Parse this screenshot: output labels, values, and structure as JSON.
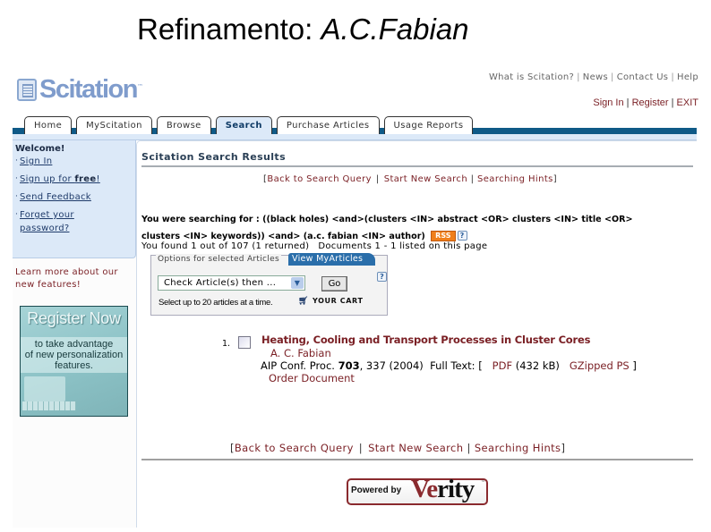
{
  "slide": {
    "title_prefix": "Refinamento: ",
    "title_italic": "A.C.Fabian"
  },
  "header": {
    "logo_text": "Scitation",
    "logo_tm": "™",
    "top_links": [
      "What is Scitation?",
      "News",
      "Contact Us",
      "Help"
    ],
    "auth_links": [
      "Sign In",
      "Register",
      "EXIT"
    ]
  },
  "tabs": [
    {
      "label": "Home",
      "active": false
    },
    {
      "label": "MyScitation",
      "active": false
    },
    {
      "label": "Browse",
      "active": false
    },
    {
      "label": "Search",
      "active": true
    },
    {
      "label": "Purchase Articles",
      "active": false
    },
    {
      "label": "Usage Reports",
      "active": false
    }
  ],
  "sidebar": {
    "welcome_heading": "Welcome!",
    "items": [
      {
        "label": "Sign In"
      },
      {
        "label_prefix": "Sign up for ",
        "label_bold": "free",
        "label_suffix": "!"
      },
      {
        "label": "Send Feedback"
      },
      {
        "label_line1": "Forget your",
        "label_line2": "password?"
      }
    ],
    "learn_more": "Learn more about our new features!",
    "promo": {
      "heading": "Register Now",
      "body_line1": "to take advantage",
      "body_line2": "of new personalization",
      "body_line3": "features."
    }
  },
  "main": {
    "section_title": "Scitation Search Results",
    "nav_links": [
      "Back to Search Query",
      "Start New Search",
      "Searching Hints"
    ],
    "query_label": "You were searching for : ",
    "query_line1": "((black holes) <and>(clusters <IN> abstract <OR> clusters <IN> title <OR>",
    "query_line2": "clusters <IN> keywords)) <and> (a.c. fabian <IN> author)",
    "rss_label": "RSS",
    "help_icon": "?",
    "found_text": "You found 1 out of 107 (1 returned)",
    "docs_text": "Documents 1 - 1 listed on this page",
    "options": {
      "tab_label": "Options for selected Articles",
      "view_tab_label": "View MyArticles",
      "select_value": "Check Article(s) then ...",
      "go_label": "Go",
      "note": "Select up to 20 articles at a time.",
      "cart_label": "YOUR CART"
    },
    "results": [
      {
        "number": "1.",
        "title": "Heating, Cooling and Transport Processes in Cluster Cores",
        "author": "A. C. Fabian",
        "journal": "AIP Conf. Proc. ",
        "volume": "703",
        "pages_year": ", 337 (2004)",
        "fulltext_label": "Full Text: [",
        "pdf_label": "PDF",
        "pdf_size": "(432 kB)",
        "gz_label": "GZipped PS",
        "fulltext_close": "]",
        "order_label": "Order Document"
      }
    ],
    "footer_nav_links": [
      "Back to Search Query",
      "Start New Search",
      "Searching Hints"
    ],
    "powered_by": "Powered by",
    "verity_a": "Ve",
    "verity_b": "rity",
    "verity_tm": "™"
  }
}
